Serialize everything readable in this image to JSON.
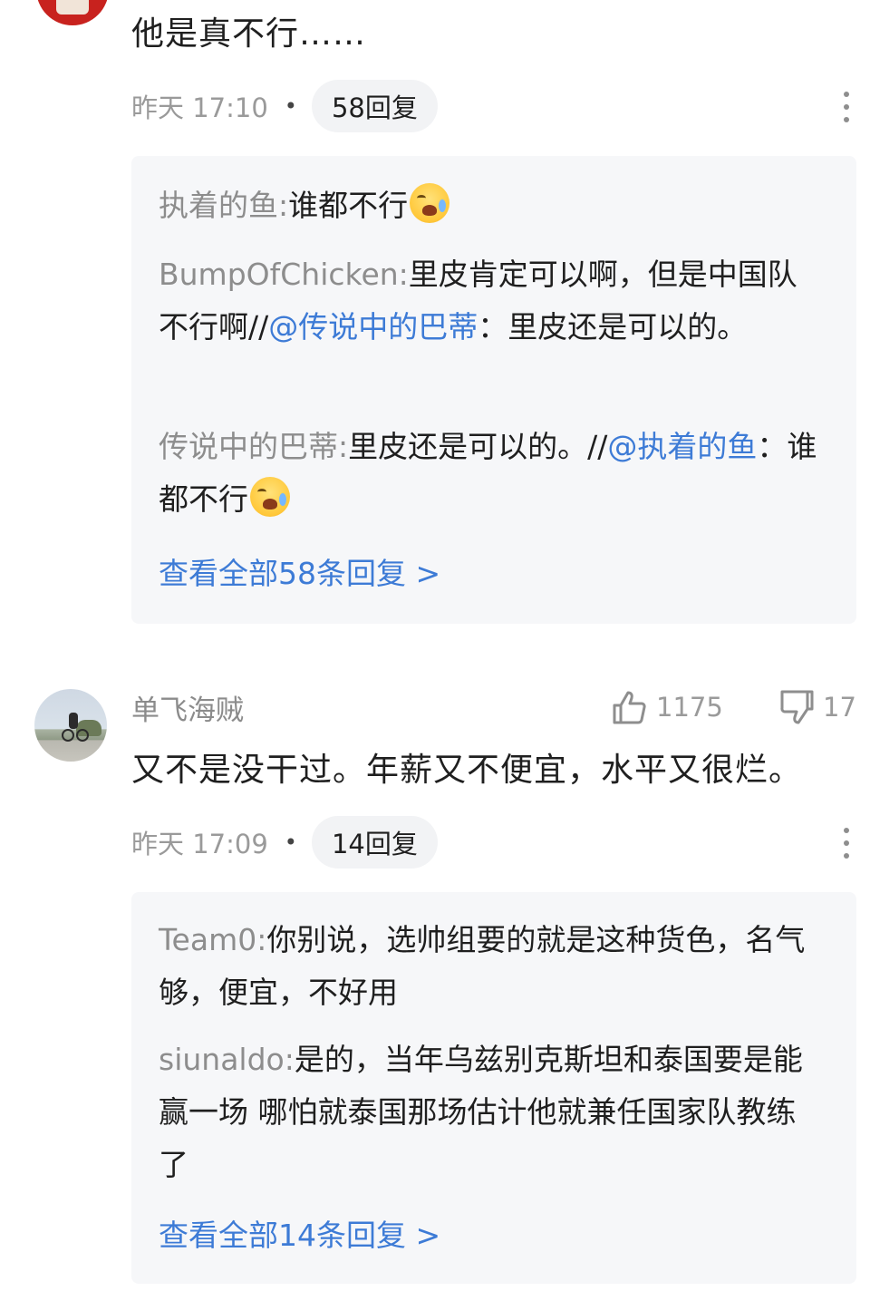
{
  "comment1": {
    "text": "他是真不行……",
    "time": "昨天 17:10",
    "reply_count_label": "58回复",
    "replies": [
      {
        "user": "执着的鱼:",
        "text": "谁都不行",
        "emoji": true
      },
      {
        "user": "BumpOfChicken:",
        "text_before": "里皮肯定可以啊，但是中国队不行啊//",
        "at": "@传说中的巴蒂",
        "text_after": "：里皮还是可以的。"
      },
      {
        "user": "传说中的巴蒂:",
        "text_before": "里皮还是可以的。//",
        "at": "@执着的鱼",
        "text_after": "：谁都不行",
        "emoji": true
      }
    ],
    "view_all": "查看全部58条回复 >"
  },
  "comment2": {
    "username": "单飞海贼",
    "likes": "1175",
    "dislikes": "17",
    "text": "又不是没干过。年薪又不便宜，水平又很烂。",
    "time": "昨天 17:09",
    "reply_count_label": "14回复",
    "replies": [
      {
        "user": "Team0:",
        "text": "你别说，选帅组要的就是这种货色，名气够，便宜，不好用"
      },
      {
        "user": "siunaldo:",
        "text": "是的，当年乌兹别克斯坦和泰国要是能赢一场 哪怕就泰国那场估计他就兼任国家队教练了"
      }
    ],
    "view_all": "查看全部14条回复 >"
  },
  "colors": {
    "link": "#3d7bd6",
    "muted": "#9a9a9a",
    "reply_bg": "#f6f7f9"
  }
}
